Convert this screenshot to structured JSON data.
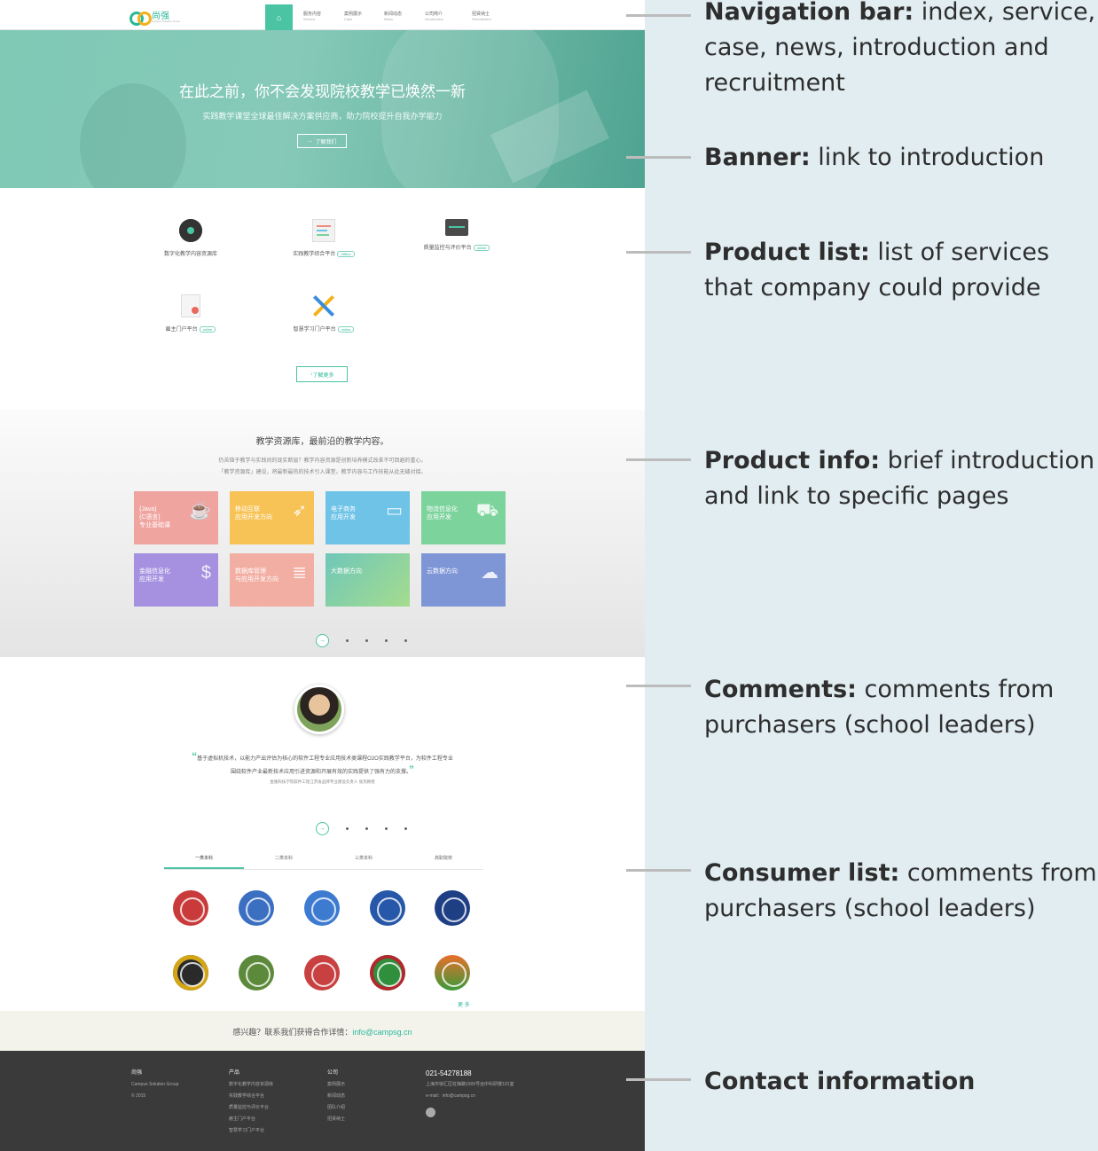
{
  "site": {
    "logo_text": "尚强",
    "logo_sub": "Campus Solution Group",
    "nav_items": [
      {
        "zh": "服务内容",
        "en": "Service"
      },
      {
        "zh": "案例展示",
        "en": "Case"
      },
      {
        "zh": "新闻动态",
        "en": "News"
      },
      {
        "zh": "公司简介",
        "en": "Introduction"
      },
      {
        "zh": "招贤纳士",
        "en": "Recruitment"
      }
    ],
    "banner": {
      "title": "在此之前，你不会发现院校教学已焕然一新",
      "subtitle": "实践教学课堂全球最佳解决方案供应商，助力院校提升自我办学能力",
      "button": "了解我们"
    },
    "products": [
      {
        "label": "数字化教学内容资源库",
        "tag": ""
      },
      {
        "label": "实践教学综合平台",
        "tag": "Offline"
      },
      {
        "label": "质量监控与评价平台",
        "tag": "online"
      },
      {
        "label": "雇主门户平台",
        "tag": "online"
      },
      {
        "label": "智慧学习门户平台",
        "tag": "online"
      }
    ],
    "more_button": "了解更多",
    "info": {
      "title": "教学资源库，最前沿的教学内容。",
      "desc_line1": "仍苦恼于教学与实践间的现实断层？教学内容资源是创新培养模式改革不可回避的重心。",
      "desc_line2": "「教学资源库」建设，将最新最热的技术引入课堂。教学内容与工作技能从此无缝对接。",
      "tiles": [
        {
          "line1": "{Java}",
          "line2": "{C语言}",
          "line3": "专业基础课",
          "icon": "cup-icon",
          "color": "#f0a4a0"
        },
        {
          "line1": "移动互联",
          "line2": "应用开发方向",
          "line3": "",
          "icon": "swift-bird-icon",
          "color": "#f7c356"
        },
        {
          "line1": "电子商务",
          "line2": "应用开发",
          "line3": "",
          "icon": "monitor-cart-icon",
          "color": "#6ec3e7"
        },
        {
          "line1": "物流信息化",
          "line2": "应用开发",
          "line3": "",
          "icon": "cart-icon",
          "color": "#7cd39c"
        },
        {
          "line1": "金融信息化",
          "line2": "应用开发",
          "line3": "",
          "icon": "money-bag-icon",
          "color": "#a591e0"
        },
        {
          "line1": "数据库管理",
          "line2": "与应用开发方向",
          "line3": "",
          "icon": "database-icon",
          "color": "#f2aea2"
        },
        {
          "line1": "大数据方向",
          "line2": "",
          "line3": "",
          "icon": "gradient-icon",
          "color": "#7fd0a6"
        },
        {
          "line1": "云数据方向",
          "line2": "",
          "line3": "",
          "icon": "cloud-icon",
          "color": "#7e95d6"
        }
      ]
    },
    "comment": {
      "quote_line1": "基于虚拟机技术，以能力产出评估为核心的软件工程专业应用技术类课程O2O实践教学平台，为软件工程专业",
      "quote_line2": "围绕软件产业最新技术应用引进资源和开展有效的实践提供了强有力的支撑。",
      "author": "金陵科技学院软件工程江苏省品牌专业建设负责人 张亮教授"
    },
    "consumer_tabs": [
      "一类本科",
      "二类本科",
      "三类本科",
      "高职院校"
    ],
    "more_link": "更 多",
    "contact_text": "感兴趣？联系我们获得合作详情：",
    "contact_email": "info@campsg.cn",
    "footer": {
      "brand": "尚强",
      "brand_sub": "Campus Solution Group",
      "copyright": "© 2015",
      "products_title": "产品",
      "products": [
        "数字化教学内容资源库",
        "实践教学综合平台",
        "质量监控与评价平台",
        "雇主门户平台",
        "智慧学习门户平台"
      ],
      "company_title": "公司",
      "company": [
        "案例展示",
        "新闻动态",
        "团队介绍",
        "招贤纳士"
      ],
      "phone": "021-54278188",
      "address": "上海市徐汇区虹梅路1905号远中科研楼101室",
      "email": "e-mail：info@campsg.cn"
    }
  },
  "annotations": [
    {
      "title": "Navigation bar:",
      "text": " index, service, case, news, introduction and recruitment"
    },
    {
      "title": "Banner:",
      "text": " link to introduction"
    },
    {
      "title": "Product list:",
      "text": " list of services that company could provide"
    },
    {
      "title": "Product info:",
      "text": " brief introduction and link to specific pages"
    },
    {
      "title": "Comments:",
      "text": " comments from purchasers (school leaders)"
    },
    {
      "title": "Consumer list:",
      "text": " comments from purchasers (school leaders)"
    },
    {
      "title": "Contact information",
      "text": ""
    }
  ]
}
